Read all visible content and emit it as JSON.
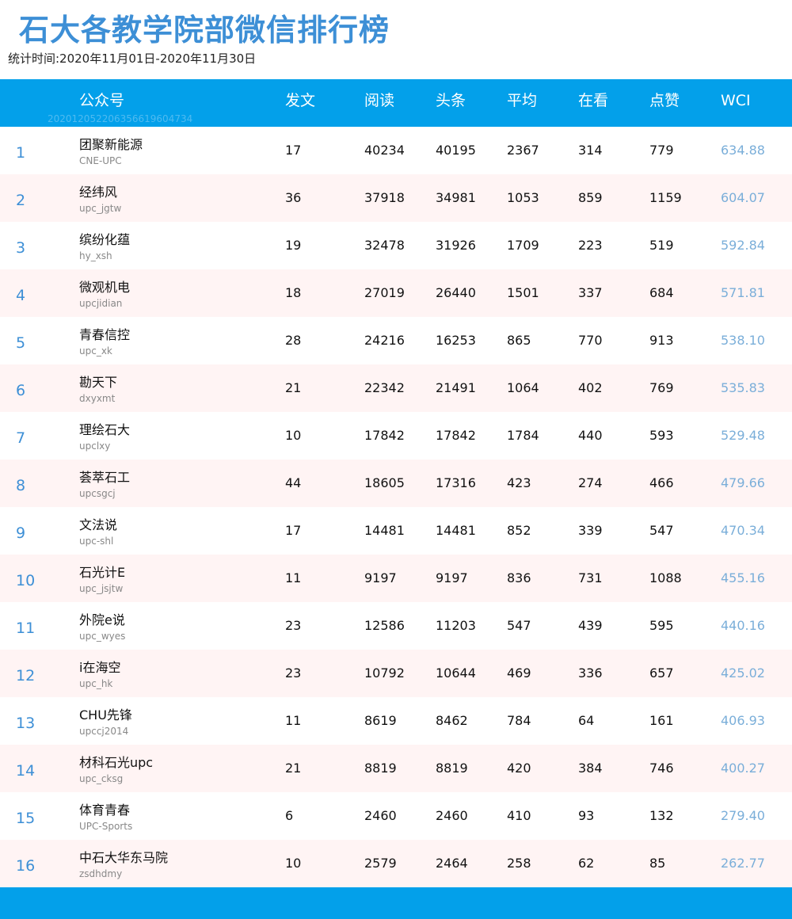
{
  "title": "石大各教学院部微信排行榜",
  "stat_period": "统计时间:2020年11月01日-2020年11月30日",
  "watermark": "20201205220635661960473​4",
  "columns": {
    "account": "公众号",
    "posts": "发文",
    "reads": "阅读",
    "headline": "头条",
    "average": "平均",
    "watching": "在看",
    "likes": "点赞",
    "wci": "WCI"
  },
  "colors": {
    "header_bg": "#03a0ea",
    "title": "#3d8fd6",
    "wci": "#7aaed9",
    "alt_row": "#fff4f4"
  },
  "rows": [
    {
      "rank": "1",
      "name": "团聚新能源",
      "id": "CNE-UPC",
      "posts": "17",
      "reads": "40234",
      "headline": "40195",
      "average": "2367",
      "watching": "314",
      "likes": "779",
      "wci": "634.88"
    },
    {
      "rank": "2",
      "name": "经纬风",
      "id": "upc_jgtw",
      "posts": "36",
      "reads": "37918",
      "headline": "34981",
      "average": "1053",
      "watching": "859",
      "likes": "1159",
      "wci": "604.07"
    },
    {
      "rank": "3",
      "name": "缤纷化蕴",
      "id": "hy_xsh",
      "posts": "19",
      "reads": "32478",
      "headline": "31926",
      "average": "1709",
      "watching": "223",
      "likes": "519",
      "wci": "592.84"
    },
    {
      "rank": "4",
      "name": "微观机电",
      "id": "upcjidian",
      "posts": "18",
      "reads": "27019",
      "headline": "26440",
      "average": "1501",
      "watching": "337",
      "likes": "684",
      "wci": "571.81"
    },
    {
      "rank": "5",
      "name": "青春信控",
      "id": "upc_xk",
      "posts": "28",
      "reads": "24216",
      "headline": "16253",
      "average": "865",
      "watching": "770",
      "likes": "913",
      "wci": "538.10"
    },
    {
      "rank": "6",
      "name": "勘天下",
      "id": "dxyxmt",
      "posts": "21",
      "reads": "22342",
      "headline": "21491",
      "average": "1064",
      "watching": "402",
      "likes": "769",
      "wci": "535.83"
    },
    {
      "rank": "7",
      "name": "理绘石大",
      "id": "upclxy",
      "posts": "10",
      "reads": "17842",
      "headline": "17842",
      "average": "1784",
      "watching": "440",
      "likes": "593",
      "wci": "529.48"
    },
    {
      "rank": "8",
      "name": "荟萃石工",
      "id": "upcsgcj",
      "posts": "44",
      "reads": "18605",
      "headline": "17316",
      "average": "423",
      "watching": "274",
      "likes": "466",
      "wci": "479.66"
    },
    {
      "rank": "9",
      "name": "文法说",
      "id": "upc-shl",
      "posts": "17",
      "reads": "14481",
      "headline": "14481",
      "average": "852",
      "watching": "339",
      "likes": "547",
      "wci": "470.34"
    },
    {
      "rank": "10",
      "name": "石光计E",
      "id": "upc_jsjtw",
      "posts": "11",
      "reads": "9197",
      "headline": "9197",
      "average": "836",
      "watching": "731",
      "likes": "1088",
      "wci": "455.16"
    },
    {
      "rank": "11",
      "name": "外院e说",
      "id": "upc_wyes",
      "posts": "23",
      "reads": "12586",
      "headline": "11203",
      "average": "547",
      "watching": "439",
      "likes": "595",
      "wci": "440.16"
    },
    {
      "rank": "12",
      "name": "i在海空",
      "id": "upc_hk",
      "posts": "23",
      "reads": "10792",
      "headline": "10644",
      "average": "469",
      "watching": "336",
      "likes": "657",
      "wci": "425.02"
    },
    {
      "rank": "13",
      "name": "CHU先锋",
      "id": "upccj2014",
      "posts": "11",
      "reads": "8619",
      "headline": "8462",
      "average": "784",
      "watching": "64",
      "likes": "161",
      "wci": "406.93"
    },
    {
      "rank": "14",
      "name": "材科石光upc",
      "id": "upc_cksg",
      "posts": "21",
      "reads": "8819",
      "headline": "8819",
      "average": "420",
      "watching": "384",
      "likes": "746",
      "wci": "400.27"
    },
    {
      "rank": "15",
      "name": "体育青春",
      "id": "UPC-Sports",
      "posts": "6",
      "reads": "2460",
      "headline": "2460",
      "average": "410",
      "watching": "93",
      "likes": "132",
      "wci": "279.40"
    },
    {
      "rank": "16",
      "name": "中石大华东马院",
      "id": "zsdhdmy",
      "posts": "10",
      "reads": "2579",
      "headline": "2464",
      "average": "258",
      "watching": "62",
      "likes": "85",
      "wci": "262.77"
    }
  ]
}
